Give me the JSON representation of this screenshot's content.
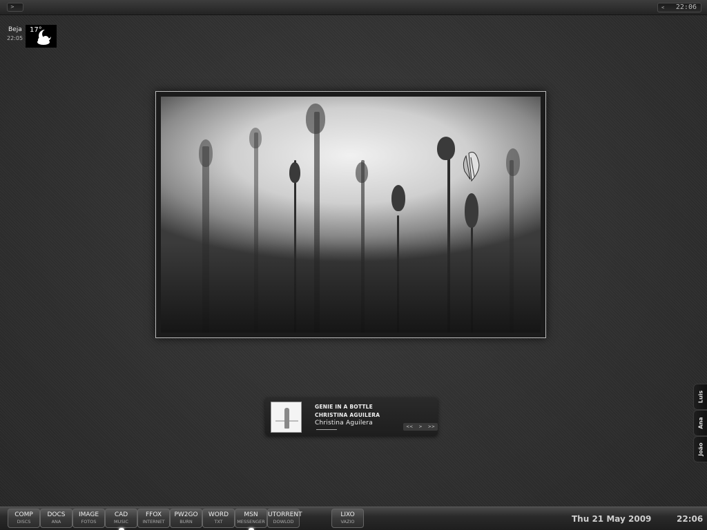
{
  "topbar": {
    "left_button_glyph": ">",
    "clock_arrow_glyph": "<",
    "clock": "22:06"
  },
  "weather": {
    "city": "Beja",
    "time": "22:05",
    "temperature": "17°",
    "icon": "moon-cloud-icon"
  },
  "wallpaper_photo": {
    "icon": "butterfly-on-flowers-photo"
  },
  "player": {
    "title": "GENIE IN A BOTTLE",
    "artist": "CHRISTINA AGUILERA",
    "album": "Christina Aguilera",
    "progress": 0.12,
    "controls": [
      "<<",
      ">",
      ">>"
    ]
  },
  "user_tabs": [
    "Luis",
    "Ana",
    "João"
  ],
  "dock": {
    "items": [
      {
        "label": "COMP",
        "sub": "DISCS",
        "active": false
      },
      {
        "label": "DOCS",
        "sub": "ANA",
        "active": false
      },
      {
        "label": "IMAGE",
        "sub": "FOTOS",
        "active": false
      },
      {
        "label": "CAD",
        "sub": "MUSIC",
        "active": true
      },
      {
        "label": "FFOX",
        "sub": "INTERNET",
        "active": false
      },
      {
        "label": "PW2GO",
        "sub": "BURN",
        "active": false
      },
      {
        "label": "WORD",
        "sub": "TXT",
        "active": false
      },
      {
        "label": "MSN",
        "sub": "MESSENGER",
        "active": true
      },
      {
        "label": "UTORRENT",
        "sub": "DOWLOD",
        "active": false
      }
    ],
    "trash": {
      "label": "LIXO",
      "sub": "VAZIO"
    },
    "date": "Thu 21 May 2009",
    "time": "22:06"
  }
}
